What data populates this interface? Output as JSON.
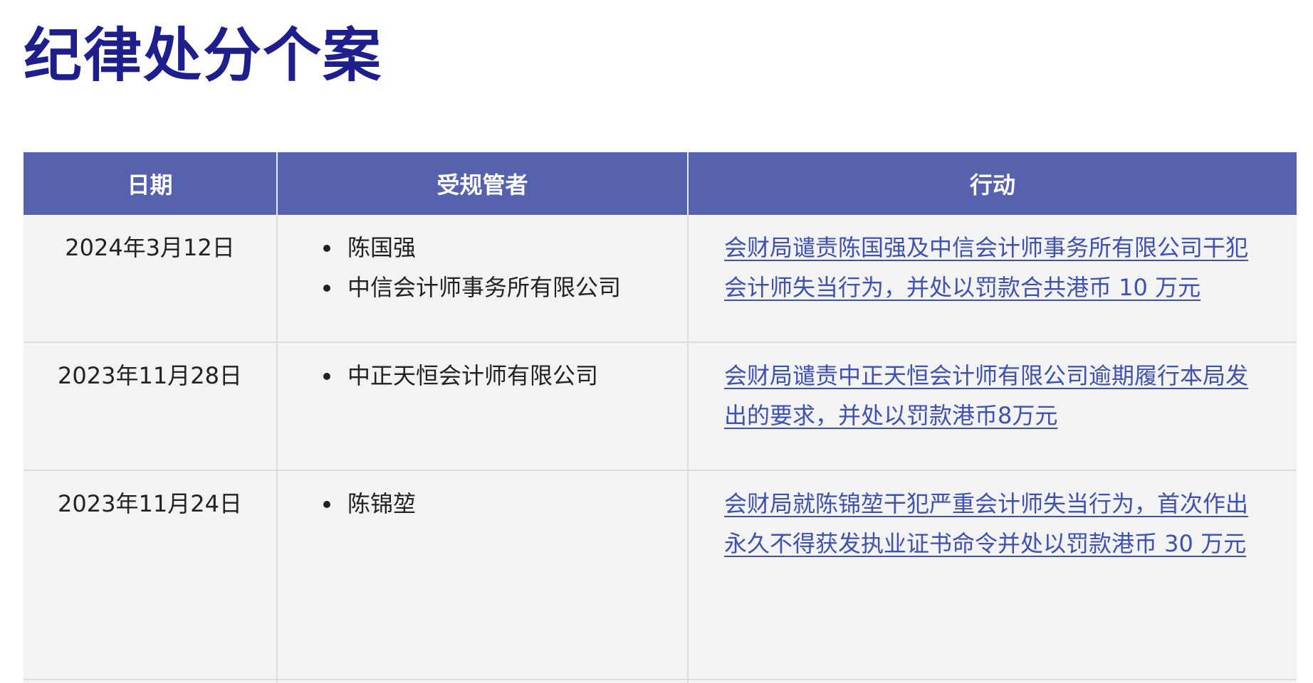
{
  "page": {
    "title": "纪律处分个案"
  },
  "table": {
    "headers": [
      "日期",
      "受规管者",
      "行动"
    ],
    "rows": [
      {
        "date": "2024年3月12日",
        "parties": [
          "陈国强",
          "中信会计师事务所有限公司"
        ],
        "action": "会财局谴责陈国强及中信会计师事务所有限公司干犯会计师失当行为，并处以罚款合共港币 10 万元"
      },
      {
        "date": "2023年11月28日",
        "parties": [
          "中正天恒会计师有限公司"
        ],
        "action": "会财局谴责中正天恒会计师有限公司逾期履行本局发出的要求，并处以罚款港币8万元"
      },
      {
        "date": "2023年11月24日",
        "parties": [
          "陈锦堃"
        ],
        "action": "会财局就陈锦堃干犯严重会计师失当行为，首次作出永久不得获发执业证书命令并处以罚款港币 30 万元"
      }
    ]
  },
  "colors": {
    "title": "#1e1e8c",
    "header_bg": "#5662ad",
    "row_bg": "#f3f3f3",
    "link": "#3f51b0"
  }
}
